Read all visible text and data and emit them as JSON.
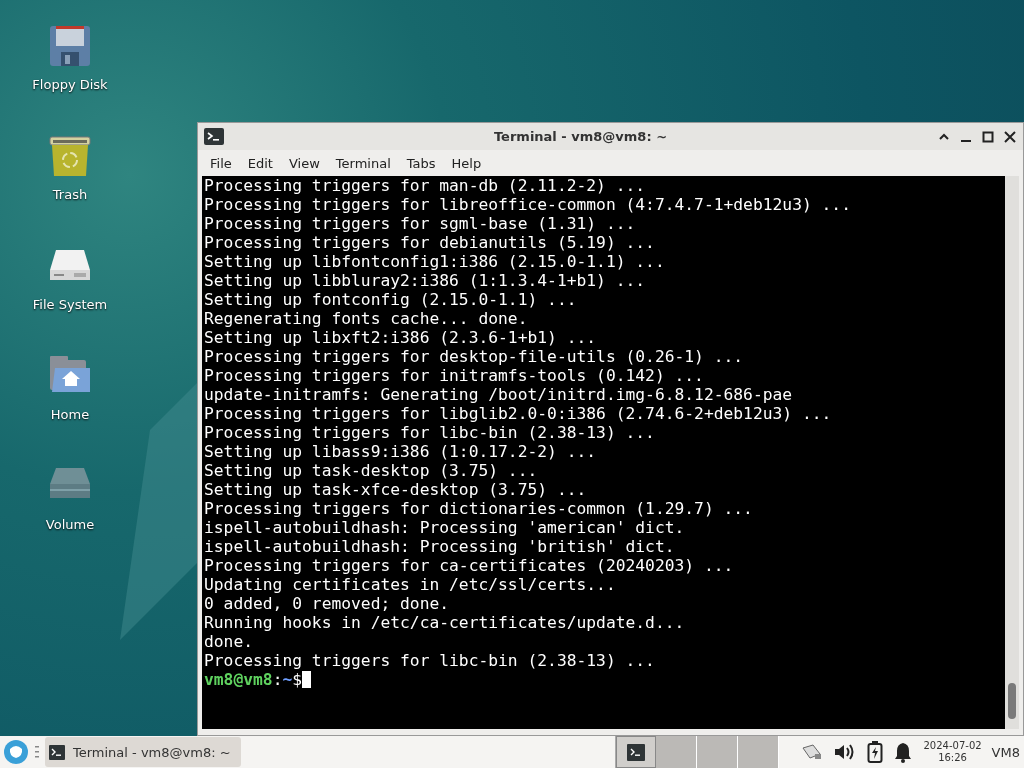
{
  "desktop_icons": [
    {
      "kind": "floppy",
      "label": "Floppy Disk"
    },
    {
      "kind": "trash",
      "label": "Trash"
    },
    {
      "kind": "drive",
      "label": "File System"
    },
    {
      "kind": "home",
      "label": "Home"
    },
    {
      "kind": "volume",
      "label": "Volume"
    }
  ],
  "window": {
    "title": "Terminal - vm8@vm8: ~",
    "menu": [
      "File",
      "Edit",
      "View",
      "Terminal",
      "Tabs",
      "Help"
    ],
    "lines": [
      "Processing triggers for man-db (2.11.2-2) ...",
      "Processing triggers for libreoffice-common (4:7.4.7-1+deb12u3) ...",
      "Processing triggers for sgml-base (1.31) ...",
      "Processing triggers for debianutils (5.19) ...",
      "Setting up libfontconfig1:i386 (2.15.0-1.1) ...",
      "Setting up libbluray2:i386 (1:1.3.4-1+b1) ...",
      "Setting up fontconfig (2.15.0-1.1) ...",
      "Regenerating fonts cache... done.",
      "Setting up libxft2:i386 (2.3.6-1+b1) ...",
      "Processing triggers for desktop-file-utils (0.26-1) ...",
      "Processing triggers for initramfs-tools (0.142) ...",
      "update-initramfs: Generating /boot/initrd.img-6.8.12-686-pae",
      "Processing triggers for libglib2.0-0:i386 (2.74.6-2+deb12u3) ...",
      "Processing triggers for libc-bin (2.38-13) ...",
      "Setting up libass9:i386 (1:0.17.2-2) ...",
      "Setting up task-desktop (3.75) ...",
      "Setting up task-xfce-desktop (3.75) ...",
      "Processing triggers for dictionaries-common (1.29.7) ...",
      "ispell-autobuildhash: Processing 'american' dict.",
      "ispell-autobuildhash: Processing 'british' dict.",
      "Processing triggers for ca-certificates (20240203) ...",
      "Updating certificates in /etc/ssl/certs...",
      "0 added, 0 removed; done.",
      "Running hooks in /etc/ca-certificates/update.d...",
      "done.",
      "Processing triggers for libc-bin (2.38-13) ..."
    ],
    "prompt": {
      "user_host": "vm8@vm8",
      "separator": ":",
      "path": "~",
      "symbol": "$"
    }
  },
  "taskbar": {
    "task": {
      "label": "Terminal - vm8@vm8: ~",
      "selected": true
    },
    "workspaces": [
      {
        "selected": true,
        "has_window": true
      },
      {
        "selected": false,
        "has_window": false
      },
      {
        "selected": false,
        "has_window": false
      },
      {
        "selected": false,
        "has_window": false
      }
    ],
    "date": "2024-07-02",
    "time": "16:26",
    "user": "VM8"
  }
}
